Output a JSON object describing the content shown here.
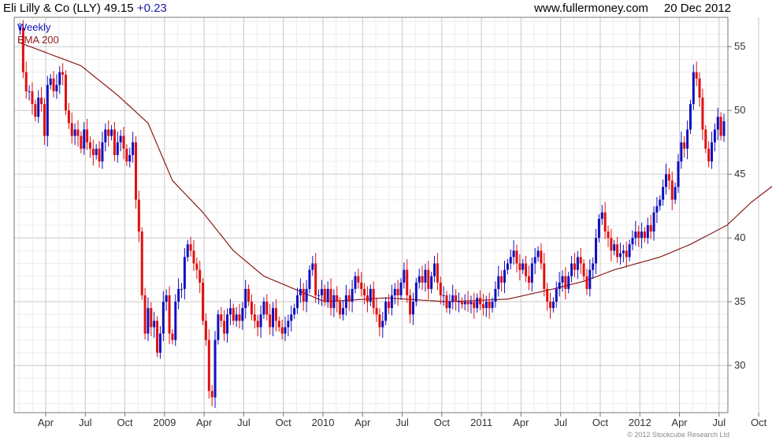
{
  "header": {
    "title": "Eli Lilly & Co (LLY) 49.15",
    "change": "+0.23",
    "website": "www.fullermoney.com",
    "date": "20 Dec 2012"
  },
  "legend": {
    "series1": "Weekly",
    "series2": "EMA 200"
  },
  "copyright": "© 2012 Stockcube Research Ltd",
  "colors": {
    "up": "#1010c0",
    "down": "#e01010",
    "ema": "#8b1a1a",
    "grid": "#c8c8c8",
    "axis": "#777777"
  },
  "chart_data": {
    "type": "candlestick",
    "frequency": "weekly",
    "x_tick_labels": [
      "Apr",
      "Jul",
      "Oct",
      "2009",
      "Apr",
      "Jul",
      "Oct",
      "2010",
      "Apr",
      "Jul",
      "Oct",
      "2011",
      "Apr",
      "Jul",
      "Oct",
      "2012",
      "Apr",
      "Jul",
      "Oct"
    ],
    "y_ticks": [
      30,
      35,
      40,
      45,
      50,
      55
    ],
    "ylim": [
      26.3,
      57.3
    ],
    "grid": true,
    "series": [
      {
        "name": "Weekly",
        "type": "candlestick",
        "close": [
          56.5,
          53.0,
          51.5,
          51.5,
          50.5,
          49.5,
          51.0,
          50.5,
          48.0,
          52.0,
          52.5,
          51.5,
          52.0,
          53.0,
          52.8,
          50.0,
          49.0,
          48.0,
          48.5,
          48.0,
          47.0,
          48.5,
          47.5,
          47.0,
          46.5,
          47.0,
          46.0,
          47.5,
          48.5,
          48.0,
          48.5,
          46.5,
          47.5,
          48.0,
          47.0,
          46.0,
          46.5,
          47.5,
          43.0,
          40.5,
          35.5,
          32.5,
          34.5,
          33.0,
          33.5,
          31.0,
          32.5,
          35.0,
          35.5,
          32.5,
          32.0,
          35.0,
          36.0,
          36.0,
          38.5,
          39.5,
          39.0,
          38.0,
          37.5,
          36.5,
          33.5,
          32.0,
          28.0,
          27.5,
          32.0,
          34.0,
          33.5,
          32.5,
          34.0,
          34.5,
          33.5,
          34.0,
          33.5,
          34.5,
          36.0,
          35.0,
          34.0,
          33.5,
          33.0,
          34.0,
          35.0,
          34.0,
          33.0,
          34.5,
          33.5,
          33.0,
          32.5,
          33.0,
          33.5,
          34.0,
          34.5,
          35.5,
          36.0,
          35.0,
          36.0,
          37.5,
          38.0,
          35.5,
          35.5,
          36.0,
          35.0,
          36.0,
          34.5,
          35.5,
          35.0,
          34.0,
          34.5,
          35.5,
          35.0,
          36.0,
          37.0,
          36.5,
          36.0,
          35.5,
          35.0,
          36.0,
          34.5,
          34.0,
          33.0,
          33.5,
          35.0,
          34.5,
          35.5,
          36.0,
          35.5,
          36.5,
          37.5,
          35.5,
          34.0,
          35.0,
          36.5,
          37.0,
          36.5,
          37.5,
          36.0,
          37.0,
          38.0,
          36.5,
          35.5,
          35.5,
          34.5,
          35.0,
          35.5,
          35.0,
          35.0,
          34.8,
          35.0,
          34.8,
          35.0,
          34.5,
          35.3,
          34.8,
          34.5,
          35.0,
          34.5,
          35.0,
          36.0,
          37.0,
          36.5,
          37.5,
          38.0,
          38.5,
          39.0,
          38.0,
          37.5,
          38.0,
          37.0,
          36.5,
          38.0,
          38.5,
          39.0,
          38.0,
          36.0,
          35.0,
          34.5,
          35.0,
          36.0,
          36.5,
          37.0,
          36.0,
          37.0,
          38.0,
          37.5,
          38.5,
          38.0,
          37.0,
          36.0,
          37.5,
          38.0,
          40.0,
          41.5,
          42.0,
          40.5,
          40.0,
          39.0,
          39.5,
          38.5,
          38.8,
          39.0,
          38.5,
          39.5,
          40.0,
          40.5,
          40.0,
          40.5,
          40.0,
          41.0,
          40.5,
          42.0,
          42.5,
          43.0,
          44.0,
          45.0,
          44.5,
          43.0,
          44.0,
          46.0,
          47.5,
          47.0,
          48.5,
          50.5,
          53.0,
          52.5,
          51.0,
          48.5,
          47.0,
          46.0,
          47.5,
          48.5,
          49.5,
          48.0,
          49.15
        ]
      },
      {
        "name": "EMA 200",
        "type": "line",
        "keypoints": [
          [
            0,
            55.3
          ],
          [
            20,
            53.5
          ],
          [
            32,
            51.2
          ],
          [
            42,
            49.0
          ],
          [
            50,
            44.5
          ],
          [
            60,
            42.0
          ],
          [
            70,
            39.0
          ],
          [
            80,
            37.0
          ],
          [
            100,
            35.0
          ],
          [
            120,
            35.3
          ],
          [
            140,
            35.0
          ],
          [
            160,
            35.2
          ],
          [
            175,
            36.0
          ],
          [
            185,
            36.6
          ],
          [
            195,
            37.5
          ],
          [
            210,
            38.5
          ],
          [
            220,
            39.5
          ],
          [
            232,
            41.0
          ],
          [
            240,
            42.8
          ],
          [
            252,
            45.0
          ]
        ]
      }
    ]
  }
}
